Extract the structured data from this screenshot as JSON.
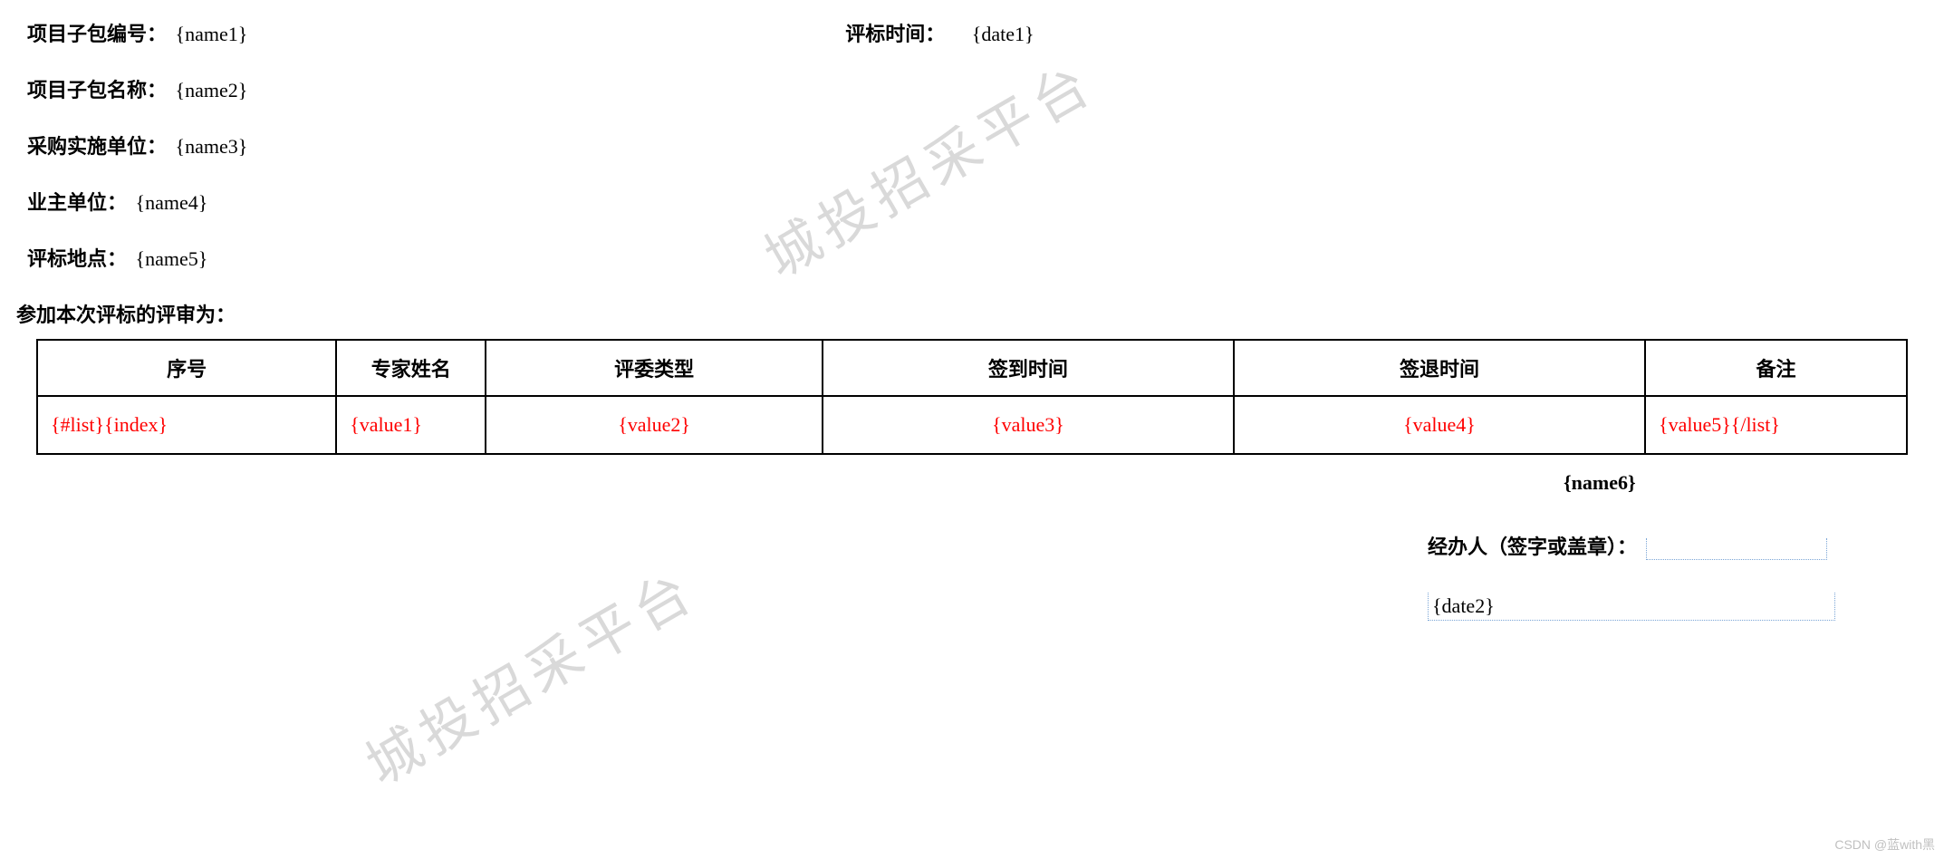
{
  "watermark_text": "城投招采平台",
  "header": {
    "field1": {
      "label": "项目子包编号：",
      "value": "{name1}"
    },
    "field_date": {
      "label": "评标时间：",
      "value": "{date1}"
    },
    "field2": {
      "label": "项目子包名称：",
      "value": "{name2}"
    },
    "field3": {
      "label": "采购实施单位：",
      "value": "{name3}"
    },
    "field4": {
      "label": "业主单位：",
      "value": "{name4}"
    },
    "field5": {
      "label": "评标地点：",
      "value": "{name5}"
    },
    "reviewer_line": "参加本次评标的评审为："
  },
  "table": {
    "headers": {
      "seq": "序号",
      "expert_name": "专家姓名",
      "judge_type": "评委类型",
      "checkin_time": "签到时间",
      "checkout_time": "签退时间",
      "remark": "备注"
    },
    "row": {
      "seq": "{#list}{index}",
      "expert_name": "{value1}",
      "judge_type": "{value2}",
      "checkin_time": "{value3}",
      "checkout_time": "{value4}",
      "remark": "{value5}{/list}"
    }
  },
  "footer": {
    "name6": "{name6}",
    "sign_label": "经办人（签字或盖章）：",
    "date2": "{date2}"
  },
  "credit": "CSDN @蓝with黑"
}
